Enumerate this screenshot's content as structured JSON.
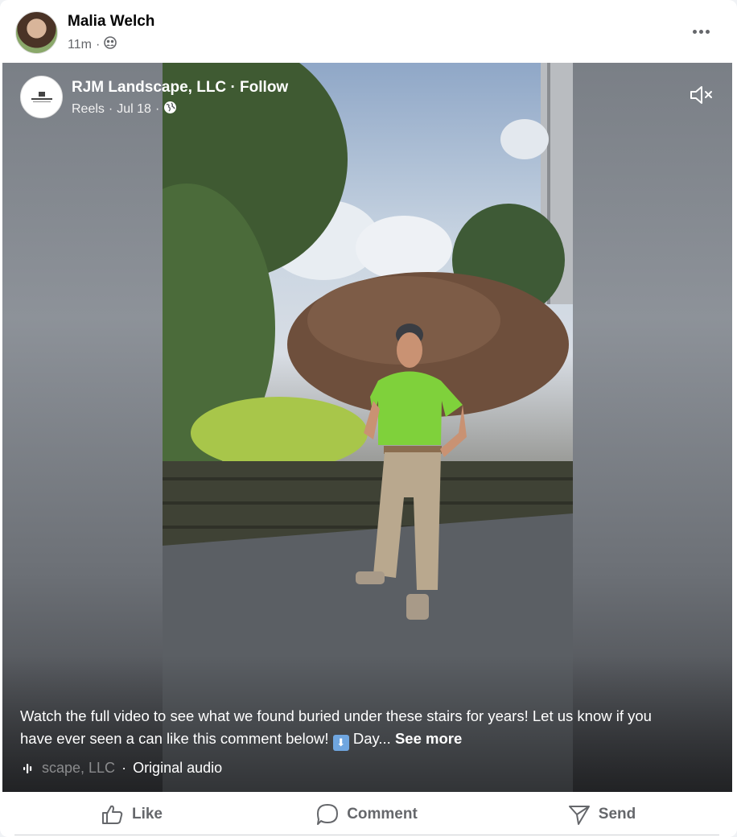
{
  "post": {
    "author": "Malia Welch",
    "time": "11m",
    "separator": "·",
    "audience_icon": "friends-icon",
    "more_icon": "more-horizontal-icon"
  },
  "reel": {
    "page_name": "RJM Landscape, LLC",
    "separator": "·",
    "follow": "Follow",
    "source": "Reels",
    "date": "Jul 18",
    "privacy_icon": "globe-icon",
    "mute_icon": "volume-muted-icon",
    "caption_part1": "Watch the full video to see what we found buried under these stairs for years! Let us know if you have ever seen a can like this comment below! ",
    "caption_emoji": "⬇",
    "caption_part2": " Day...",
    "see_more": "See more",
    "audio_partial": "scape, LLC",
    "audio_separator": "·",
    "audio_label": "Original audio"
  },
  "actions": {
    "like": "Like",
    "comment": "Comment",
    "send": "Send"
  },
  "colors": {
    "secondary_text": "#65676b",
    "primary_text": "#050505",
    "shirt": "#7fd13b"
  }
}
